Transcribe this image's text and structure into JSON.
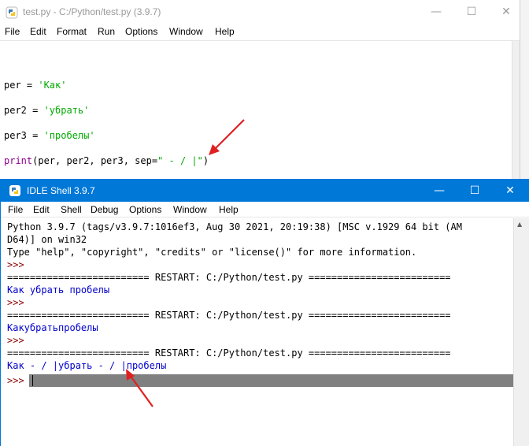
{
  "editor_window": {
    "title": "test.py - C:/Python/test.py (3.9.7)",
    "controls": {
      "minimize": "—",
      "maximize": "☐",
      "close": "✕"
    },
    "menu": [
      "File",
      "Edit",
      "Format",
      "Run",
      "Options",
      "Window",
      "Help"
    ],
    "code": {
      "line1_var": "per = ",
      "line1_str": "'Как'",
      "line2_var": "per2 = ",
      "line2_str": "'убрать'",
      "line3_var": "per3 = ",
      "line3_str": "'пробелы'",
      "line4_fn": "print",
      "line4_args": "(per, per2, per3, sep=",
      "line4_str": "\" - / |\"",
      "line4_end": ")"
    }
  },
  "shell_window": {
    "title": "IDLE Shell 3.9.7",
    "controls": {
      "minimize": "—",
      "maximize": "☐",
      "close": "✕"
    },
    "menu": [
      "File",
      "Edit",
      "Shell",
      "Debug",
      "Options",
      "Window",
      "Help"
    ],
    "lines": {
      "l1": "Python 3.9.7 (tags/v3.9.7:1016ef3, Aug 30 2021, 20:19:38) [MSC v.1929 64 bit (AM",
      "l2": "D64)] on win32",
      "l3": "Type \"help\", \"copyright\", \"credits\" or \"license()\" for more information.",
      "prompt": ">>>",
      "restart": "========================= RESTART: C:/Python/test.py =========================",
      "out1": "Как убрать пробелы",
      "out2": "Какубратьпробелы",
      "out3": "Как - / |убрать - / |пробелы"
    }
  },
  "colors": {
    "string": "#00aa00",
    "builtin": "#900090",
    "output": "#0000cc",
    "prompt": "#8b0000",
    "titlebar_active": "#0078d7",
    "annotation_arrow": "#e02020"
  }
}
